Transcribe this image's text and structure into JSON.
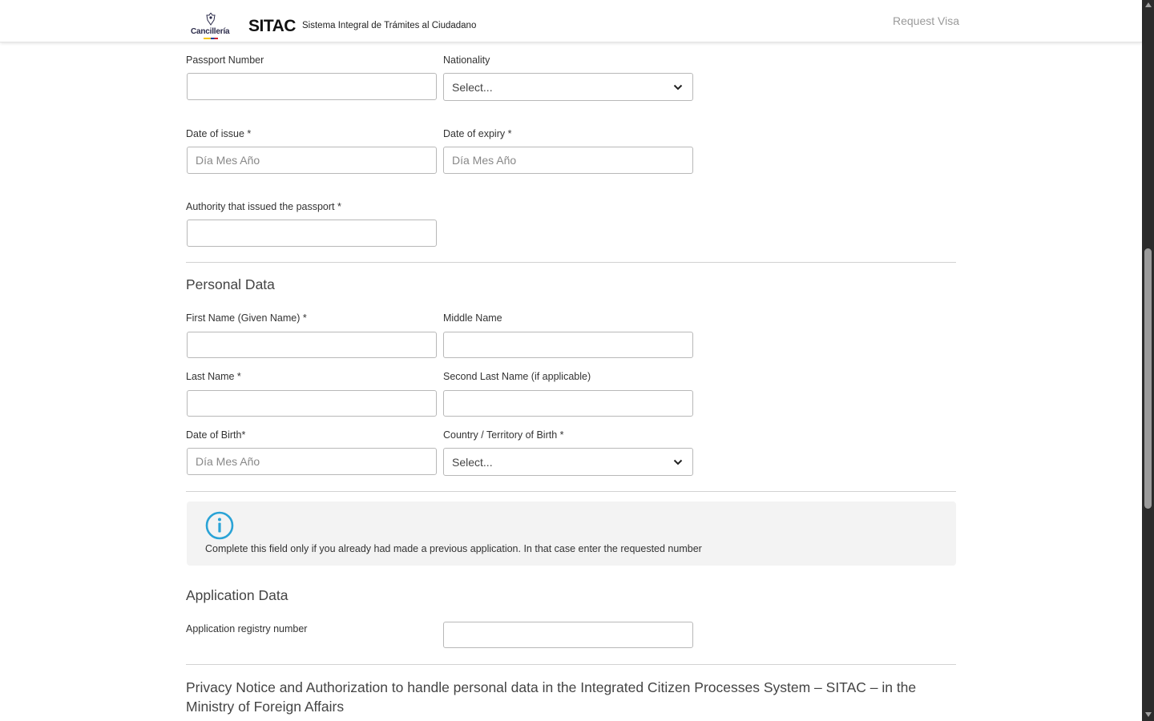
{
  "header": {
    "logo_text": "Cancillería",
    "title": "SITAC",
    "subtitle": "Sistema Integral de Trámites al Ciudadano",
    "request_visa": "Request Visa"
  },
  "passport": {
    "passport_number_label": "Passport Number",
    "passport_number_value": "",
    "nationality_label": "Nationality",
    "nationality_selected": "Select...",
    "date_of_issue_label": "Date of issue *",
    "date_of_issue_placeholder": "Día Mes Año",
    "date_of_expiry_label": "Date of expiry *",
    "date_of_expiry_placeholder": "Día Mes Año",
    "authority_label": "Authority that issued the passport *",
    "authority_value": ""
  },
  "personal": {
    "section_title": "Personal Data",
    "first_name_label": "First Name (Given Name) *",
    "middle_name_label": "Middle Name",
    "last_name_label": "Last Name *",
    "second_last_name_label": "Second Last Name (if applicable)",
    "dob_label": "Date of Birth*",
    "dob_placeholder": "Día Mes Año",
    "country_birth_label": "Country / Territory of Birth *",
    "country_birth_selected": "Select..."
  },
  "info": {
    "icon": "info-icon",
    "text": "Complete this field only if you already had made a previous application. In that case enter the requested number"
  },
  "application": {
    "section_title": "Application Data",
    "registry_label": "Application registry number",
    "registry_value": ""
  },
  "privacy": {
    "title": "Privacy Notice and Authorization to handle personal data in the Integrated Citizen Processes System – SITAC – in the Ministry of Foreign Affairs"
  },
  "colors": {
    "info_icon": "#2aa3d6",
    "input_border": "#b8b8b8",
    "info_bg": "#f3f3f3"
  }
}
